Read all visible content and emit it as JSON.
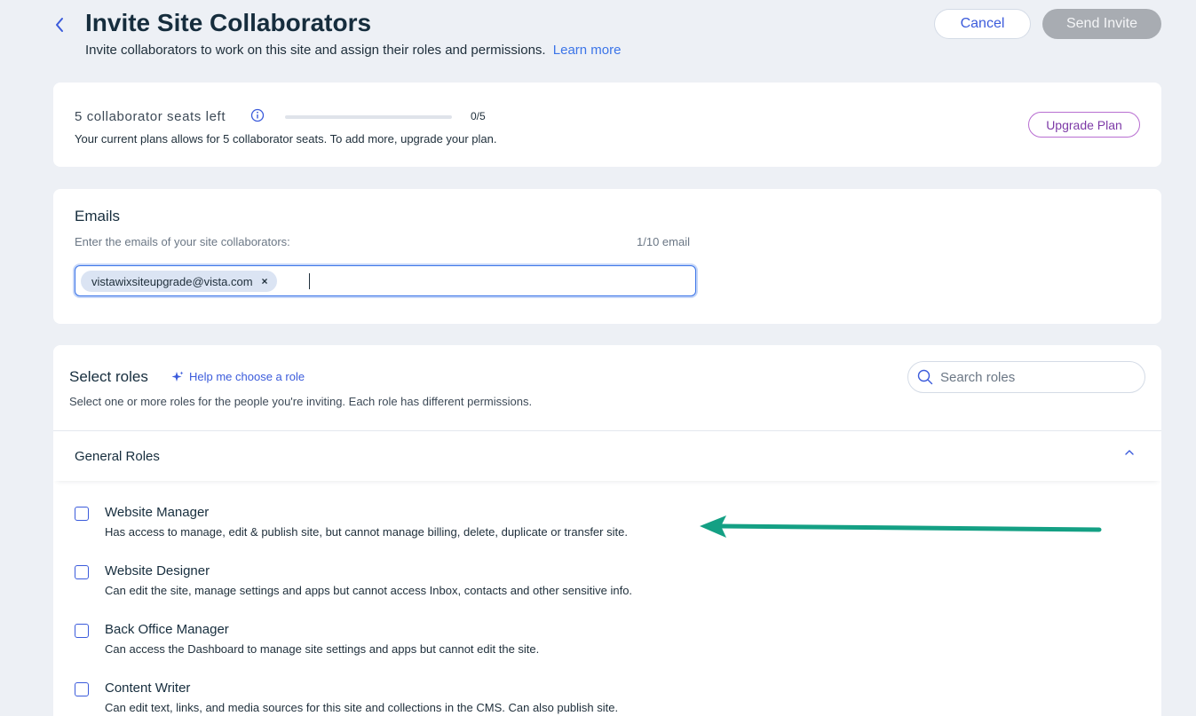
{
  "header": {
    "title": "Invite Site Collaborators",
    "subtitle": "Invite collaborators to work on this site and assign their roles and permissions.",
    "learn_more": "Learn more",
    "cancel_label": "Cancel",
    "send_label": "Send Invite"
  },
  "seats": {
    "label": "5 collaborator seats left",
    "used": 0,
    "total": 5,
    "progress_text": "0/5",
    "description": "Your current plans allows for 5 collaborator seats. To add more, upgrade your plan.",
    "upgrade_label": "Upgrade Plan"
  },
  "emails": {
    "title": "Emails",
    "description": "Enter the emails of your site collaborators:",
    "count": "1/10 email",
    "chips": [
      "vistawixsiteupgrade@vista.com"
    ],
    "chip_remove": "×"
  },
  "roles": {
    "title": "Select roles",
    "help_label": "Help me choose a role",
    "description": "Select one or more roles for the people you're inviting. Each role has different permissions.",
    "search_placeholder": "Search roles",
    "section_title": "General Roles",
    "items": [
      {
        "name": "Website Manager",
        "description": "Has access to manage, edit & publish site, but cannot manage billing, delete, duplicate or transfer site.",
        "checked": false
      },
      {
        "name": "Website Designer",
        "description": "Can edit the site, manage settings and apps but cannot access Inbox, contacts and other sensitive info.",
        "checked": false
      },
      {
        "name": "Back Office Manager",
        "description": "Can access the Dashboard to manage site settings and apps but cannot edit the site.",
        "checked": false
      },
      {
        "name": "Content Writer",
        "description": "Can edit text, links, and media sources for this site and collections in the CMS. Can also publish site.",
        "checked": false
      }
    ]
  },
  "colors": {
    "accent": "#3b5bdb",
    "link": "#3b74e8",
    "upgrade": "#7d3aa7",
    "annotation_arrow": "#14a084",
    "background": "#edf0f5"
  },
  "icons": {
    "back": "chevron-left-icon",
    "info": "info-icon",
    "help": "sparkle-icon",
    "search": "search-icon",
    "collapse": "chevron-up-icon",
    "annotation": "arrow-left-icon"
  }
}
